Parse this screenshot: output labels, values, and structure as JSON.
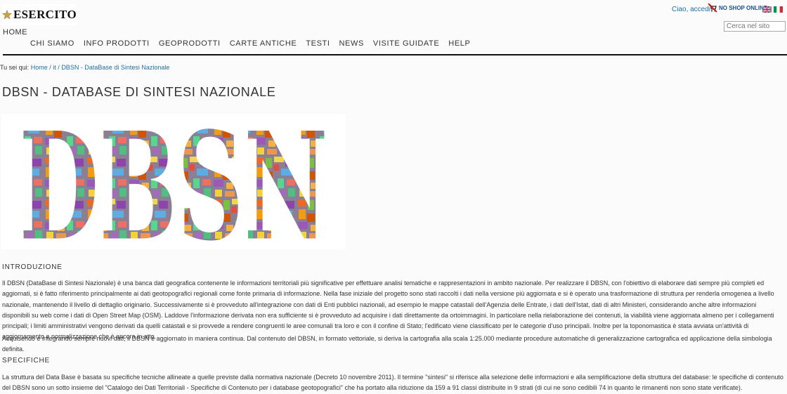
{
  "header": {
    "brand": "ESERCITO",
    "login": "Ciao, accedi",
    "no_shop": "NO SHOP ONLINE",
    "search_placeholder": "Cerca nel sito"
  },
  "nav": {
    "home": "HOME",
    "items": [
      "CHI SIAMO",
      "INFO PRODOTTI",
      "GEOPRODOTTI",
      "CARTE ANTICHE",
      "TESTI",
      "NEWS",
      "VISITE GUIDATE",
      "HELP"
    ]
  },
  "breadcrumb": {
    "prefix": "Tu sei qui:",
    "home": "Home",
    "sep1": "/",
    "it": "it",
    "sep2": "/",
    "current": "DBSN - DataBase di Sintesi Nazionale"
  },
  "page": {
    "title": "DBSN - DATABASE DI SINTESI NAZIONALE",
    "banner_text": "DBSN",
    "intro_heading": "INTRODUZIONE",
    "intro_p1": "Il DBSN (DataBase di Sintesi Nazionale) è una banca dati geografica contenente le informazioni territoriali più significative per effettuare analisi tematiche e rappresentazioni in ambito nazionale. Per realizzare il DBSN, con l'obiettivo di elaborare dati sempre più completi ed aggiornati, si è fatto riferimento principalmente ai dati geotopografici regionali come fonte primaria di informazione. Nella fase iniziale del progetto sono stati raccolti i dati nella versione più aggiornata e si è operato una trasformazione di struttura per renderla omogenea a livello nazionale, mantenendo il livello di dettaglio originario. Successivamente si è provveduto all'integrazione con dati di Enti pubblici nazionali, ad esempio le mappe catastali dell'Agenzia delle Entrate, i dati dell'Istat, dati di altri Ministeri, considerando anche altre informazioni disponibili su web come i dati di Open Street Map (OSM). Laddove l'informazione derivata non era sufficiente si è provveduto ad acquisire i dati direttamente da ortoimmagini. In particolare nella rielaborazione dei contenuti, la viabilità viene aggiornata almeno per i collegamenti principali; i limiti amministrativi vengono derivati da quelli catastali e si provvede a rendere congruenti le aree comunali tra loro e con il confine di Stato; l'edificato viene classificato per le categorie d'uso principali. Inoltre per la toponomastica è stata avviata un'attività di aggiornamento e normalizzazione che è ancora in atto.",
    "intro_p2": "Acquisendo e integrando sempre nuovi dati, il DBSN è aggiornato in maniera continua. Dal contenuto del DBSN, in formato vettoriale, si deriva la cartografia alla scala 1:25.000 mediante procedure automatiche di generalizzazione cartografica ed applicazione della simbologia definita.",
    "spec_heading": "SPECIFICHE",
    "spec_p1": "La struttura del Data Base è basata su specifiche tecniche allineate a quelle previste dalla normativa nazionale (Decreto 10 novembre 2011). Il termine \"sintesi\" si riferisce alla selezione delle informazioni e alla semplificazione della struttura del database: le specifiche di contenuto del DBSN sono un sotto insieme del \"Catalogo dei Dati Territoriali - Specifiche di Contenuto per i database geotopografici\" che ha portato alla riduzione da 159 a 91 classi distribuite in 9 strati (di cui ne sono cedibili 74 in quanto le rimanenti non sono state verificate)."
  }
}
